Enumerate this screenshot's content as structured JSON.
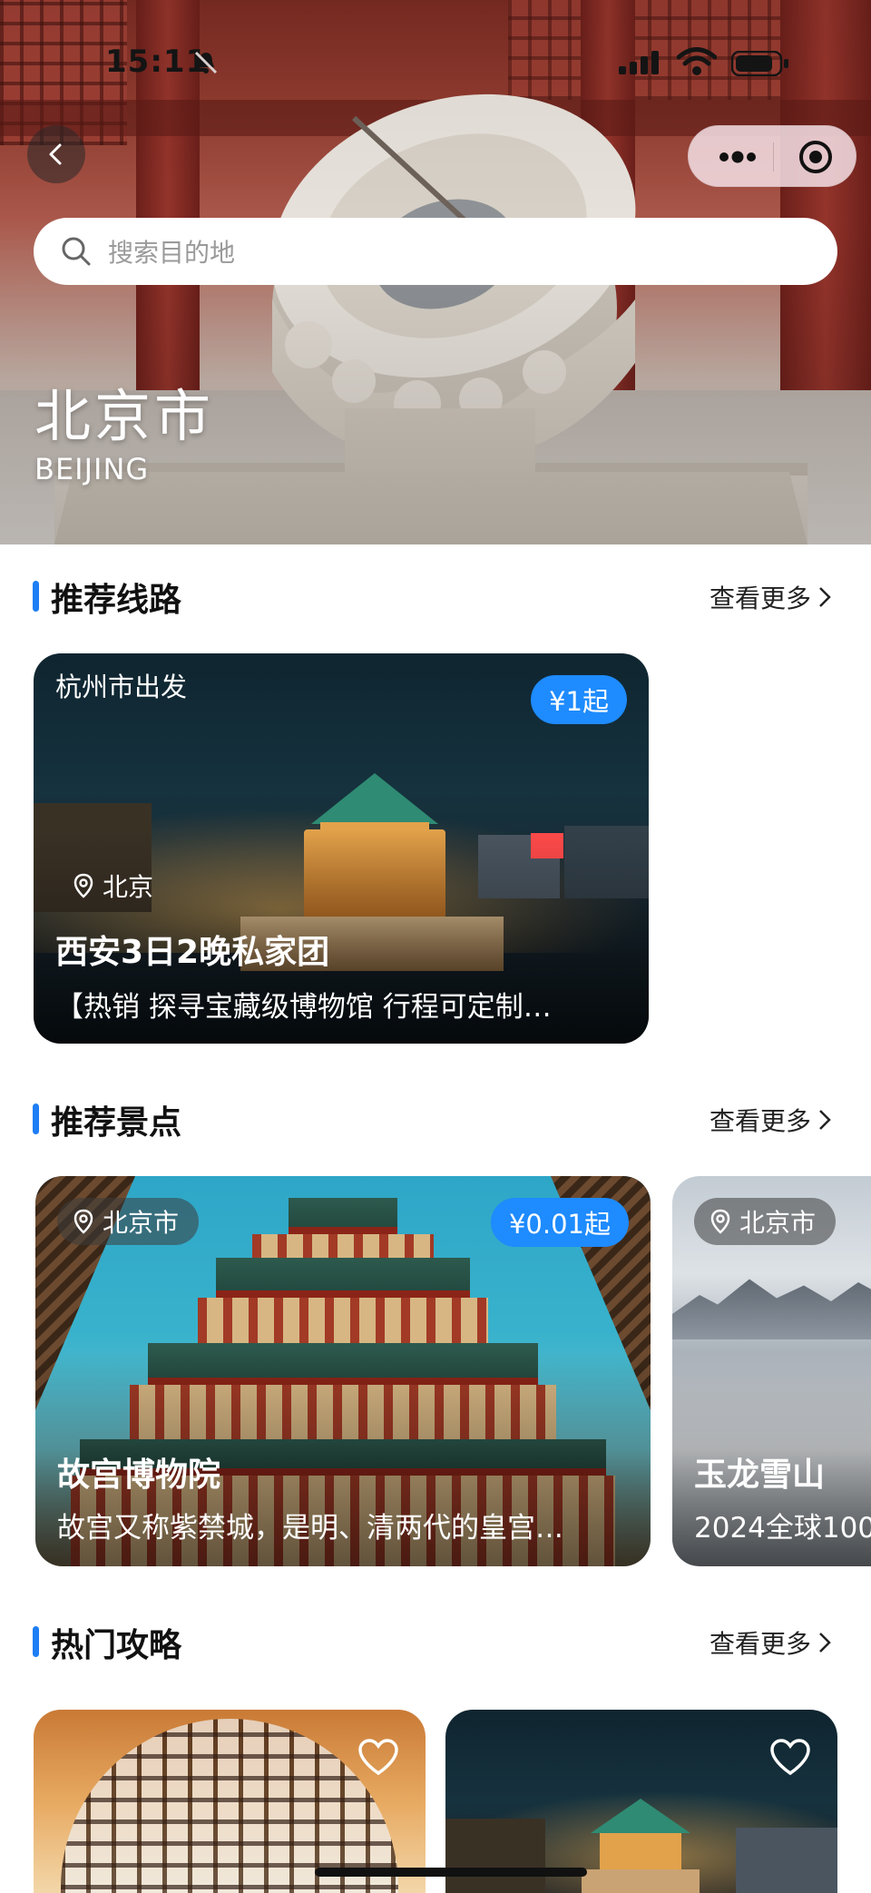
{
  "status_bar": {
    "time": "15:11"
  },
  "search": {
    "placeholder": "搜索目的地"
  },
  "hero": {
    "city": "北京市",
    "city_en": "BEIJING"
  },
  "sections": {
    "routes": {
      "title": "推荐线路",
      "more": "查看更多"
    },
    "spots": {
      "title": "推荐景点",
      "more": "查看更多"
    },
    "guides": {
      "title": "热门攻略",
      "more": "查看更多"
    }
  },
  "route_card": {
    "departure": "杭州市出发",
    "price": "¥1起",
    "location": "北京",
    "title": "西安3日2晚私家团",
    "desc": "【热销 探寻宝藏级博物馆 行程可定制…"
  },
  "spot_cards": [
    {
      "location": "北京市",
      "price": "¥0.01起",
      "title": "故宫博物院",
      "desc": "故宫又称紫禁城，是明、清两代的皇宫…"
    },
    {
      "location": "北京市",
      "title": "玉龙雪山",
      "desc": "2024全球100"
    }
  ],
  "colors": {
    "accent": "#1e7ef5",
    "price_badge": "#1e8bff"
  }
}
